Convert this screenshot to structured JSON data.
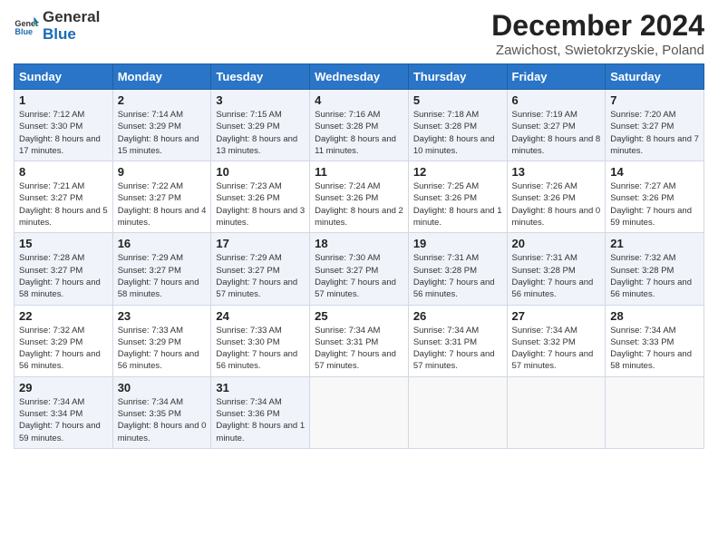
{
  "header": {
    "logo_general": "General",
    "logo_blue": "Blue",
    "title": "December 2024",
    "subtitle": "Zawichost, Swietokrzyskie, Poland"
  },
  "days_of_week": [
    "Sunday",
    "Monday",
    "Tuesday",
    "Wednesday",
    "Thursday",
    "Friday",
    "Saturday"
  ],
  "weeks": [
    [
      {
        "day": "1",
        "sunrise": "7:12 AM",
        "sunset": "3:30 PM",
        "daylight": "8 hours and 17 minutes."
      },
      {
        "day": "2",
        "sunrise": "7:14 AM",
        "sunset": "3:29 PM",
        "daylight": "8 hours and 15 minutes."
      },
      {
        "day": "3",
        "sunrise": "7:15 AM",
        "sunset": "3:29 PM",
        "daylight": "8 hours and 13 minutes."
      },
      {
        "day": "4",
        "sunrise": "7:16 AM",
        "sunset": "3:28 PM",
        "daylight": "8 hours and 11 minutes."
      },
      {
        "day": "5",
        "sunrise": "7:18 AM",
        "sunset": "3:28 PM",
        "daylight": "8 hours and 10 minutes."
      },
      {
        "day": "6",
        "sunrise": "7:19 AM",
        "sunset": "3:27 PM",
        "daylight": "8 hours and 8 minutes."
      },
      {
        "day": "7",
        "sunrise": "7:20 AM",
        "sunset": "3:27 PM",
        "daylight": "8 hours and 7 minutes."
      }
    ],
    [
      {
        "day": "8",
        "sunrise": "7:21 AM",
        "sunset": "3:27 PM",
        "daylight": "8 hours and 5 minutes."
      },
      {
        "day": "9",
        "sunrise": "7:22 AM",
        "sunset": "3:27 PM",
        "daylight": "8 hours and 4 minutes."
      },
      {
        "day": "10",
        "sunrise": "7:23 AM",
        "sunset": "3:26 PM",
        "daylight": "8 hours and 3 minutes."
      },
      {
        "day": "11",
        "sunrise": "7:24 AM",
        "sunset": "3:26 PM",
        "daylight": "8 hours and 2 minutes."
      },
      {
        "day": "12",
        "sunrise": "7:25 AM",
        "sunset": "3:26 PM",
        "daylight": "8 hours and 1 minute."
      },
      {
        "day": "13",
        "sunrise": "7:26 AM",
        "sunset": "3:26 PM",
        "daylight": "8 hours and 0 minutes."
      },
      {
        "day": "14",
        "sunrise": "7:27 AM",
        "sunset": "3:26 PM",
        "daylight": "7 hours and 59 minutes."
      }
    ],
    [
      {
        "day": "15",
        "sunrise": "7:28 AM",
        "sunset": "3:27 PM",
        "daylight": "7 hours and 58 minutes."
      },
      {
        "day": "16",
        "sunrise": "7:29 AM",
        "sunset": "3:27 PM",
        "daylight": "7 hours and 58 minutes."
      },
      {
        "day": "17",
        "sunrise": "7:29 AM",
        "sunset": "3:27 PM",
        "daylight": "7 hours and 57 minutes."
      },
      {
        "day": "18",
        "sunrise": "7:30 AM",
        "sunset": "3:27 PM",
        "daylight": "7 hours and 57 minutes."
      },
      {
        "day": "19",
        "sunrise": "7:31 AM",
        "sunset": "3:28 PM",
        "daylight": "7 hours and 56 minutes."
      },
      {
        "day": "20",
        "sunrise": "7:31 AM",
        "sunset": "3:28 PM",
        "daylight": "7 hours and 56 minutes."
      },
      {
        "day": "21",
        "sunrise": "7:32 AM",
        "sunset": "3:28 PM",
        "daylight": "7 hours and 56 minutes."
      }
    ],
    [
      {
        "day": "22",
        "sunrise": "7:32 AM",
        "sunset": "3:29 PM",
        "daylight": "7 hours and 56 minutes."
      },
      {
        "day": "23",
        "sunrise": "7:33 AM",
        "sunset": "3:29 PM",
        "daylight": "7 hours and 56 minutes."
      },
      {
        "day": "24",
        "sunrise": "7:33 AM",
        "sunset": "3:30 PM",
        "daylight": "7 hours and 56 minutes."
      },
      {
        "day": "25",
        "sunrise": "7:34 AM",
        "sunset": "3:31 PM",
        "daylight": "7 hours and 57 minutes."
      },
      {
        "day": "26",
        "sunrise": "7:34 AM",
        "sunset": "3:31 PM",
        "daylight": "7 hours and 57 minutes."
      },
      {
        "day": "27",
        "sunrise": "7:34 AM",
        "sunset": "3:32 PM",
        "daylight": "7 hours and 57 minutes."
      },
      {
        "day": "28",
        "sunrise": "7:34 AM",
        "sunset": "3:33 PM",
        "daylight": "7 hours and 58 minutes."
      }
    ],
    [
      {
        "day": "29",
        "sunrise": "7:34 AM",
        "sunset": "3:34 PM",
        "daylight": "7 hours and 59 minutes."
      },
      {
        "day": "30",
        "sunrise": "7:34 AM",
        "sunset": "3:35 PM",
        "daylight": "8 hours and 0 minutes."
      },
      {
        "day": "31",
        "sunrise": "7:34 AM",
        "sunset": "3:36 PM",
        "daylight": "8 hours and 1 minute."
      },
      null,
      null,
      null,
      null
    ]
  ]
}
